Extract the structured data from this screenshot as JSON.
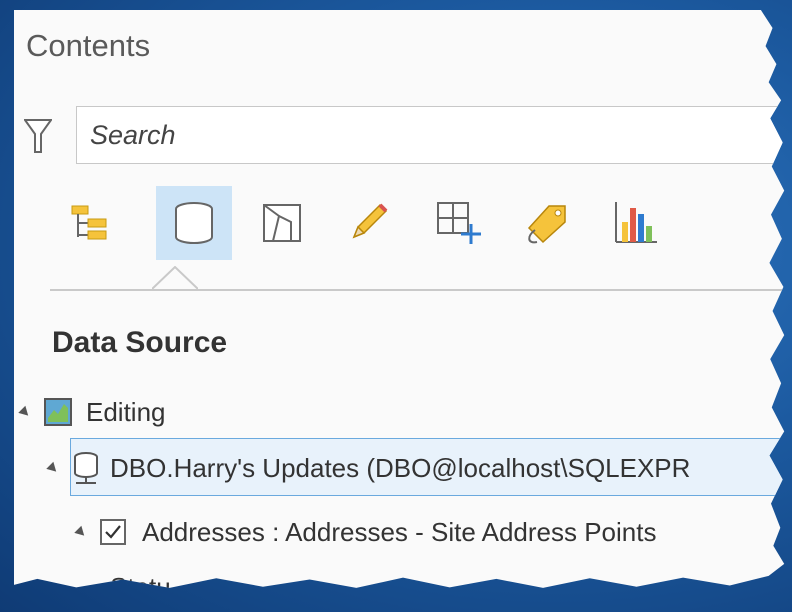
{
  "panel": {
    "title": "Contents",
    "search": {
      "placeholder": "Search"
    },
    "toolbar": [
      {
        "icon": "list-by-drawing-order-icon",
        "active": false
      },
      {
        "icon": "list-by-data-source-icon",
        "active": true
      },
      {
        "icon": "list-by-selection-icon",
        "active": false
      },
      {
        "icon": "list-by-editing-icon",
        "active": false
      },
      {
        "icon": "list-by-snapping-icon",
        "active": false
      },
      {
        "icon": "list-by-labeling-icon",
        "active": false
      },
      {
        "icon": "list-by-charts-icon",
        "active": false
      }
    ],
    "section_title": "Data Source",
    "tree": {
      "map": {
        "label": "Editing",
        "icon": "map-icon"
      },
      "connection": {
        "label": "DBO.Harry's Updates (DBO@localhost\\SQLEXPR",
        "icon": "database-icon"
      },
      "layer": {
        "label": "Addresses : Addresses - Site Address Points",
        "checked": true
      },
      "partial_label": "Statu"
    }
  },
  "colors": {
    "background": "#1c5aa0",
    "panel": "#fafafa",
    "active_tab": "#cde4f7",
    "selection_border": "#6aa9de"
  }
}
